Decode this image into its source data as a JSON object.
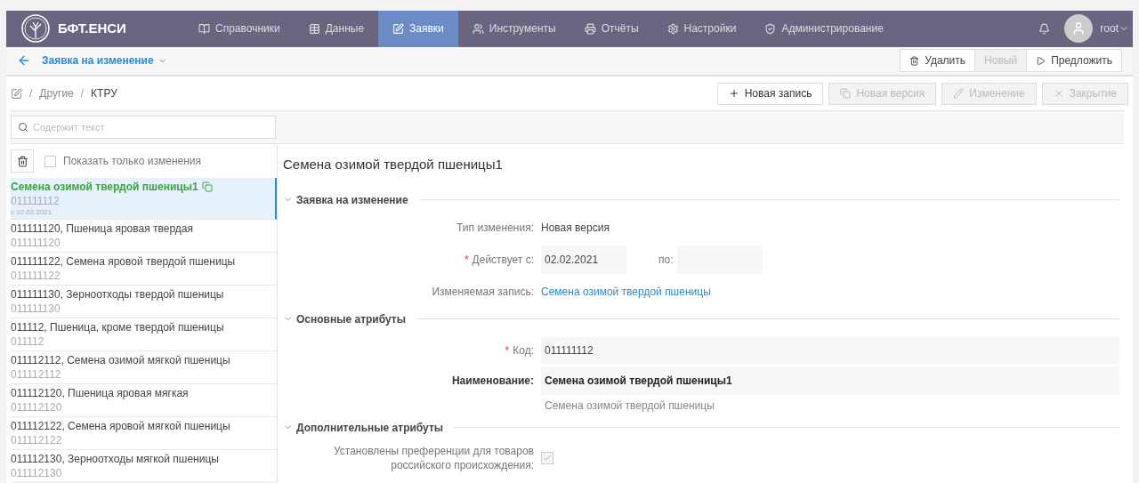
{
  "nav": {
    "brand": "БФТ.ЕНСИ",
    "items": [
      {
        "label": "Справочники",
        "selected": false
      },
      {
        "label": "Данные",
        "selected": false
      },
      {
        "label": "Заявки",
        "selected": true
      },
      {
        "label": "Инструменты",
        "selected": false
      },
      {
        "label": "Отчёты",
        "selected": false
      },
      {
        "label": "Настройки",
        "selected": false
      },
      {
        "label": "Администрирование",
        "selected": false
      }
    ],
    "user": "root"
  },
  "subheader": {
    "title": "Заявка на изменение",
    "actions": [
      {
        "label": "Удалить",
        "disabled": false
      },
      {
        "label": "Новый",
        "disabled": true
      },
      {
        "label": "Предложить",
        "disabled": false
      }
    ]
  },
  "breadcrumb": [
    {
      "kind": "sep",
      "text": "/"
    },
    {
      "kind": "link",
      "text": "Другие"
    },
    {
      "kind": "sep",
      "text": "/"
    },
    {
      "kind": "link",
      "text": "КТРУ"
    }
  ],
  "toolbar": [
    {
      "label": "Новая запись",
      "disabled": false
    },
    {
      "label": "Новая версия",
      "disabled": true
    },
    {
      "label": "Изменение",
      "disabled": true
    },
    {
      "label": "Закрытие",
      "disabled": true
    }
  ],
  "search": {
    "placeholder": "Содержит текст"
  },
  "filter": {
    "label": "Показать только изменения",
    "checked": false
  },
  "list": [
    {
      "title": "Семена озимой твердой пшеницы1",
      "code": "011111112",
      "date": "с 02.02.2021",
      "selected": true,
      "changed": true
    },
    {
      "title": "011111120, Пшеница яровая твердая",
      "code": "011111120",
      "selected": false,
      "changed": false
    },
    {
      "title": "011111122, Семена яровой твердой пшеницы",
      "code": "011111122",
      "selected": false,
      "changed": false
    },
    {
      "title": "011111130, Зерноотходы твердой пшеницы",
      "code": "011111130",
      "selected": false,
      "changed": false
    },
    {
      "title": "011112, Пшеница, кроме твердой пшеницы",
      "code": "011112",
      "selected": false,
      "changed": false
    },
    {
      "title": "011112112, Семена озимой мягкой пшеницы",
      "code": "011112112",
      "selected": false,
      "changed": false
    },
    {
      "title": "011112120, Пшеница яровая мягкая",
      "code": "011112120",
      "selected": false,
      "changed": false
    },
    {
      "title": "011112122, Семена яровой мягкой пшеницы",
      "code": "011112122",
      "selected": false,
      "changed": false
    },
    {
      "title": "011112130, Зерноотходы мягкой пшеницы",
      "code": "011112130",
      "selected": false,
      "changed": false
    }
  ],
  "detail": {
    "title": "Семена озимой твердой пшеницы1",
    "sections": [
      {
        "title": "Заявка на изменение",
        "expanded": true,
        "fields": [
          {
            "kind": "text",
            "label": "Тип изменения:",
            "value": "Новая версия"
          },
          {
            "kind": "range",
            "mark": "*",
            "label": "Действует с:",
            "value": "02.02.2021",
            "to_label": "по:"
          },
          {
            "kind": "link",
            "label": "Изменяемая запись:",
            "value": "Семена озимой твердой пшеницы"
          }
        ]
      },
      {
        "title": "Основные атрибуты",
        "expanded": true,
        "fields": [
          {
            "kind": "input",
            "mark": "*",
            "label": "Код:",
            "value": "011111112"
          },
          {
            "kind": "name",
            "label": "Наименование:",
            "value": "Семена озимой твердой пшеницы1",
            "previous": "Семена озимой твердой пшеницы"
          }
        ]
      },
      {
        "title": "Дополнительные атрибуты",
        "expanded": true,
        "fields": [
          {
            "kind": "checkbox",
            "label": "Установлены преференции для товаров российского происхождения:",
            "checked": true
          }
        ]
      }
    ]
  }
}
